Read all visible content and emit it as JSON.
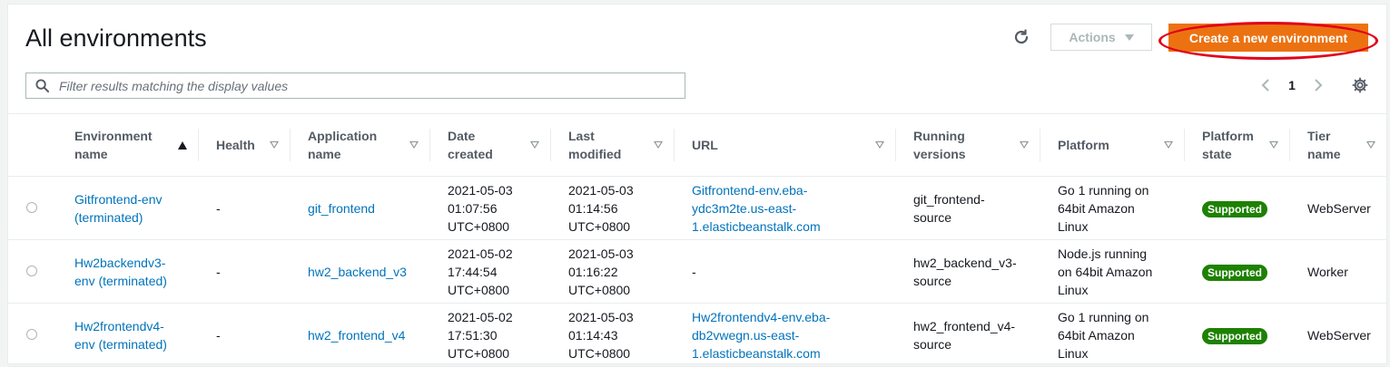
{
  "page": {
    "title": "All environments"
  },
  "toolbar": {
    "actions_label": "Actions",
    "create_label": "Create a new environment"
  },
  "filter": {
    "placeholder": "Filter results matching the display values"
  },
  "pagination": {
    "current_page": "1"
  },
  "colors": {
    "accent": "#ec7211",
    "link": "#0073bb",
    "supported": "#1d8102",
    "annotation": "#e0001a"
  },
  "table": {
    "headers": {
      "env": [
        "Environment",
        "name"
      ],
      "health": "Health",
      "app": [
        "Application",
        "name"
      ],
      "created": [
        "Date",
        "created"
      ],
      "modified": [
        "Last",
        "modified"
      ],
      "url": "URL",
      "versions": [
        "Running",
        "versions"
      ],
      "platform": "Platform",
      "pstate": [
        "Platform",
        "state"
      ],
      "tier": [
        "Tier",
        "name"
      ]
    },
    "rows": [
      {
        "env": [
          "Gitfrontend-env",
          "(terminated)"
        ],
        "health": "-",
        "app": "git_frontend",
        "created": [
          "2021-05-03",
          "01:07:56",
          "UTC+0800"
        ],
        "modified": [
          "2021-05-03",
          "01:14:56",
          "UTC+0800"
        ],
        "url": [
          "Gitfrontend-env.eba-",
          "ydc3m2te.us-east-",
          "1.elasticbeanstalk.com"
        ],
        "versions": [
          "git_frontend-",
          "source"
        ],
        "platform": [
          "Go 1 running on",
          "64bit Amazon",
          "Linux"
        ],
        "pstate": "Supported",
        "tier": "WebServer"
      },
      {
        "env": [
          "Hw2backendv3-",
          "env (terminated)"
        ],
        "health": "-",
        "app": "hw2_backend_v3",
        "created": [
          "2021-05-02",
          "17:44:54",
          "UTC+0800"
        ],
        "modified": [
          "2021-05-03",
          "01:16:22",
          "UTC+0800"
        ],
        "url": [
          "-",
          "",
          ""
        ],
        "versions": [
          "hw2_backend_v3-",
          "source"
        ],
        "platform": [
          "Node.js running",
          "on 64bit Amazon",
          "Linux"
        ],
        "pstate": "Supported",
        "tier": "Worker"
      },
      {
        "env": [
          "Hw2frontendv4-",
          "env (terminated)"
        ],
        "health": "-",
        "app": "hw2_frontend_v4",
        "created": [
          "2021-05-02",
          "17:51:30",
          "UTC+0800"
        ],
        "modified": [
          "2021-05-03",
          "01:14:43",
          "UTC+0800"
        ],
        "url": [
          "Hw2frontendv4-env.eba-",
          "db2vwegn.us-east-",
          "1.elasticbeanstalk.com"
        ],
        "versions": [
          "hw2_frontend_v4-",
          "source"
        ],
        "platform": [
          "Go 1 running on",
          "64bit Amazon",
          "Linux"
        ],
        "pstate": "Supported",
        "tier": "WebServer"
      }
    ]
  }
}
